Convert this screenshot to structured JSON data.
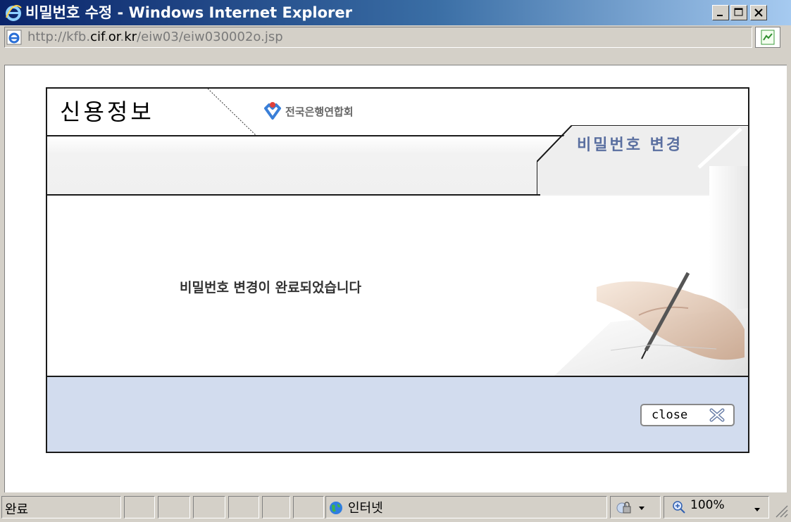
{
  "window": {
    "title": "비밀번호 수정 - Windows Internet Explorer",
    "minimize_icon": "minimize-icon",
    "maximize_icon": "maximize-icon",
    "close_icon": "close-icon"
  },
  "address": {
    "url_prefix": "http://kfb.",
    "url_host_a": "cif",
    "url_dot1": ".",
    "url_host_b": "or",
    "url_dot2": ".",
    "url_host_c": "kr",
    "url_path": "/eiw03/eiw030002o.jsp",
    "page_icon": "ie-page-icon",
    "go_icon": "go-icon"
  },
  "page": {
    "brand_title": "신용정보",
    "org_name": "전국은행연합회",
    "section_tab": "비밀번호 변경",
    "message": "비밀번호 변경이 완료되었습니다",
    "close_label": "close",
    "close_icon": "close-x-icon",
    "colors": {
      "footer_bg": "#d2dcee",
      "tab_text": "#5a6fa0",
      "logo_red": "#e0403a",
      "logo_blue": "#3a7fd8"
    }
  },
  "status": {
    "text": "완료",
    "zone": "인터넷",
    "zoom": "100%",
    "zone_icon": "globe-icon",
    "zoom_icon": "zoom-icon"
  }
}
